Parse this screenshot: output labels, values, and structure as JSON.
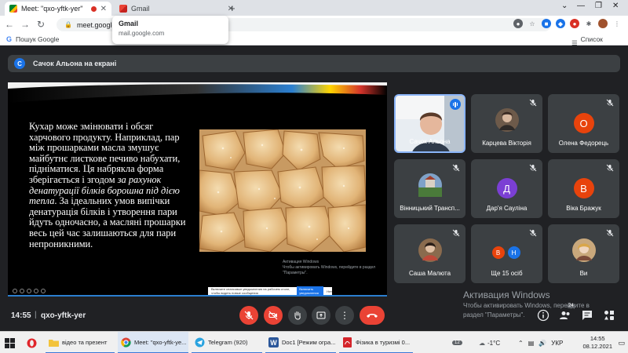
{
  "browser": {
    "tabs": [
      {
        "title": "Meet: \"qxo-yftk-yer\"",
        "active": true,
        "recording": true
      },
      {
        "title": "Gmail",
        "active": false
      }
    ],
    "tooltip": {
      "title": "Gmail",
      "url": "mail.google.com"
    },
    "address": "meet.google.com/qxo-yftk-yer",
    "bookmarks": {
      "left": "Пошук Google",
      "right": "Список читання"
    }
  },
  "meet": {
    "presenting_label": "Сачок Альона на екрані",
    "presenter_initial": "С",
    "slide": {
      "text_before": "Кухар може змінювати і обсяг харчового продукту. Наприклад, пар між прошарками масла змушує майбутнє листкове печиво набухати, підніматися. Ця набрякла форма зберігається і згодом ",
      "text_italic": "за рахунок денатурації білків борошна під дією тепла",
      "text_after": ". За ідеальних умов випічки денатурація білків і утворення пари йдуть одночасно, а масляні прошарки весь цей час залишаються для пари непроникними.",
      "watermark_title": "Активация Windows",
      "watermark_sub": "Чтобы активировать Windows, перейдите в раздел \"Параметры\".",
      "notification": "Включите сеансовые уведомления на рабочем столе, чтобы видеть новые сообщения",
      "notification_btn": "Включить уведомления",
      "notification_btn2": "Нет"
    },
    "participants": [
      {
        "name": "Сачок Альона",
        "kind": "video",
        "speaking": true
      },
      {
        "name": "Карцева Вікторія",
        "kind": "photo",
        "muted": true
      },
      {
        "name": "Олена Федорець",
        "kind": "initial",
        "initial": "О",
        "color": "#e8430c",
        "muted": true
      },
      {
        "name": "Вінницький Трансп...",
        "kind": "photo",
        "muted": true
      },
      {
        "name": "Дар'я Сауліна",
        "kind": "initial",
        "initial": "Д",
        "color": "#7b3fd4",
        "muted": true
      },
      {
        "name": "Віка Бражук",
        "kind": "initial",
        "initial": "В",
        "color": "#e8430c",
        "muted": true
      },
      {
        "name": "Саша Малюта",
        "kind": "photo",
        "muted": true
      },
      {
        "name": "Ще 15 осіб",
        "kind": "group",
        "initials": [
          "В",
          "Н"
        ],
        "colors": [
          "#e8430c",
          "#1a73e8"
        ],
        "muted": true
      },
      {
        "name": "Ви",
        "kind": "photo",
        "muted": true
      }
    ],
    "time": "14:55",
    "code": "qxo-yftk-yer",
    "people_badge": "24",
    "activation": {
      "title": "Активация Windows",
      "line1": "Чтобы активировать Windows, перейдите в",
      "line2": "раздел \"Параметры\"."
    }
  },
  "taskbar": {
    "items": [
      {
        "label": "",
        "icon": "opera-icon",
        "color": "#e0262b"
      },
      {
        "label": "відео та презент",
        "icon": "folder-icon",
        "color": "#f3c33b"
      },
      {
        "label": "Meet: \"qxo-yftk-ye...",
        "icon": "chrome-icon",
        "color": "#4285f4"
      },
      {
        "label": "Telegram (920)",
        "icon": "telegram-icon",
        "color": "#2aa3df"
      },
      {
        "label": "Doc1 [Режим огра...",
        "icon": "word-icon",
        "color": "#2b579a"
      },
      {
        "label": "Фізика в туризмі 0...",
        "icon": "pdf-icon",
        "color": "#d4242a"
      }
    ],
    "notif_count": "12",
    "temperature": "-1°C",
    "lang": "УКР",
    "clock_time": "14:55",
    "clock_date": "08.12.2021"
  },
  "colors": {
    "meet_bg": "#202124",
    "tile_bg": "#3c4043",
    "danger": "#ea4335",
    "accent": "#1a73e8"
  }
}
